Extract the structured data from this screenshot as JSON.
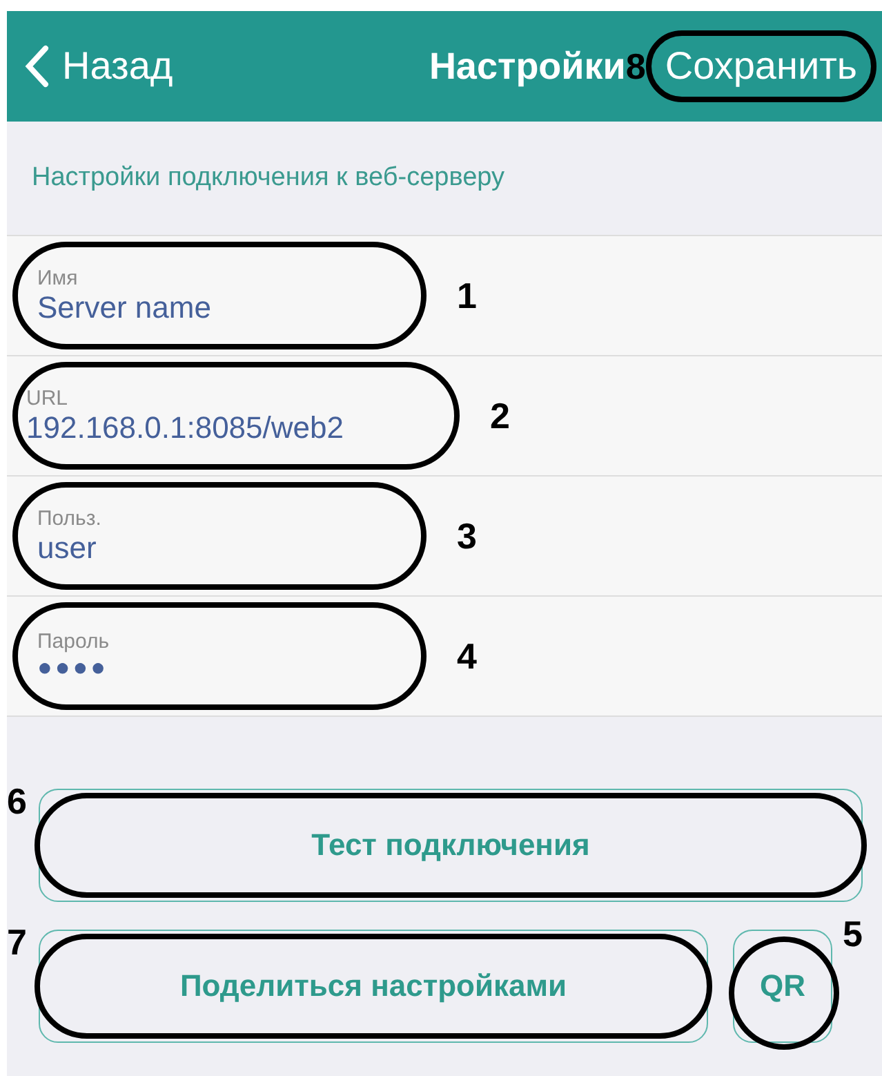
{
  "header": {
    "back": "Назад",
    "title": "Настройки",
    "save": "Сохранить",
    "save_callout": "8"
  },
  "section_title": "Настройки подключения к веб-серверу",
  "fields": [
    {
      "kind": "text",
      "label": "Имя",
      "value": "Server name",
      "callout": "1"
    },
    {
      "kind": "text",
      "label": "URL",
      "value": "192.168.0.1:8085/web2",
      "callout": "2"
    },
    {
      "kind": "text",
      "label": "Польз.",
      "value": "user",
      "callout": "3"
    },
    {
      "kind": "password",
      "label": "Пароль",
      "value": "●●●●",
      "callout": "4"
    }
  ],
  "buttons": [
    {
      "label": "Тест подключения",
      "callout": "6"
    },
    {
      "label": "Поделиться настройками",
      "callout": "7"
    },
    {
      "label": "QR",
      "callout": "5"
    }
  ]
}
